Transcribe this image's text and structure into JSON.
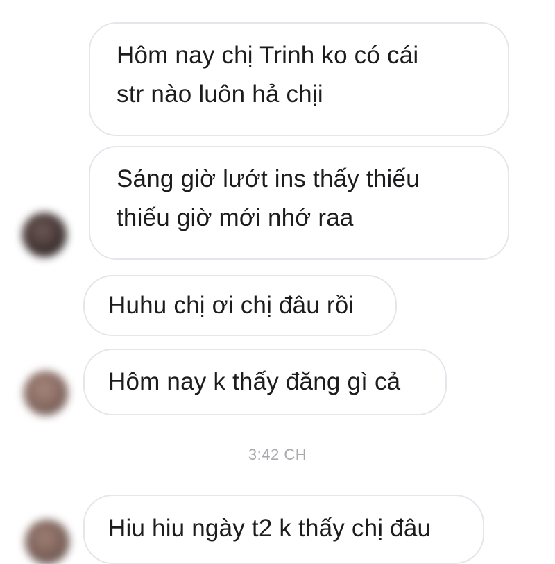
{
  "conversation": {
    "messages": [
      {
        "text_line1": "Hôm nay chị Trinh ko có cái",
        "text_line2": "str nào luôn hả chịi"
      },
      {
        "text_line1": "Sáng giờ lướt ins thấy thiếu",
        "text_line2": "thiếu giờ mới nhớ raa"
      },
      {
        "text": "Huhu chị ơi chị đâu rồi"
      },
      {
        "text": "Hôm nay k thấy đăng gì cả"
      },
      {
        "text": "Hiu hiu ngày t2 k thấy chị đâu"
      }
    ],
    "timestamp": "3:42 CH"
  }
}
